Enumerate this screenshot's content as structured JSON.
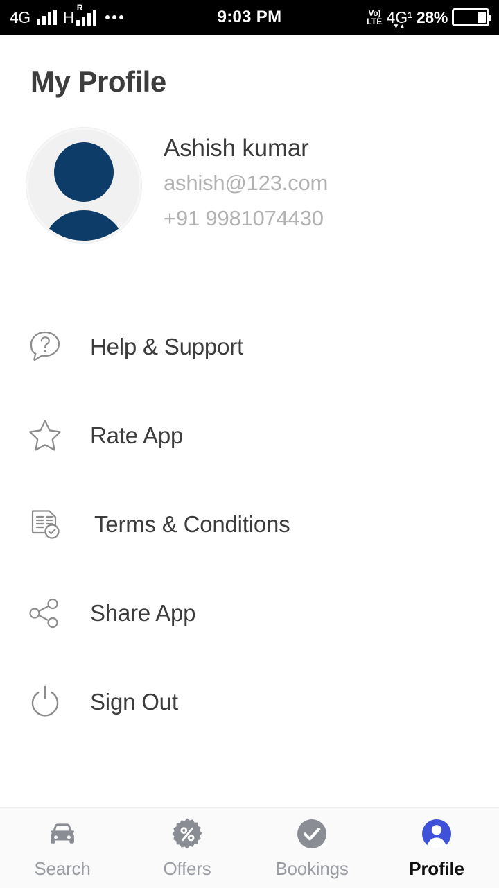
{
  "status_bar": {
    "network_label": "4G",
    "hspa_label": "H",
    "roaming_label": "R",
    "overflow_icon": "more-dots-icon",
    "clock": "9:03 PM",
    "volte_line1": "Vo)",
    "volte_line2": "LTE",
    "network_label_2": "4G",
    "network_sup": "1",
    "data_arrows": "▼▲",
    "battery_percent": "28%",
    "battery_level": 28
  },
  "header": {
    "title": "My Profile"
  },
  "profile": {
    "avatar_icon": "user-avatar-icon",
    "name": "Ashish kumar",
    "email": "ashish@123.com",
    "phone": "+91 9981074430",
    "avatar_color": "#0c3c67",
    "avatar_bg": "#f1f1f1"
  },
  "menu": {
    "items": [
      {
        "label": "Help & Support",
        "icon": "help-question-bubble-icon"
      },
      {
        "label": "Rate App",
        "icon": "star-outline-icon"
      },
      {
        "label": "Terms & Conditions",
        "icon": "document-check-icon"
      },
      {
        "label": "Share App",
        "icon": "share-nodes-icon"
      },
      {
        "label": "Sign Out",
        "icon": "power-icon"
      }
    ]
  },
  "bottom_nav": {
    "active_index": 3,
    "active_color": "#3f51d8",
    "inactive_color": "#8a8d94",
    "items": [
      {
        "label": "Search",
        "icon": "car-icon"
      },
      {
        "label": "Offers",
        "icon": "percent-badge-icon"
      },
      {
        "label": "Bookings",
        "icon": "check-circle-icon"
      },
      {
        "label": "Profile",
        "icon": "person-circle-icon"
      }
    ]
  }
}
